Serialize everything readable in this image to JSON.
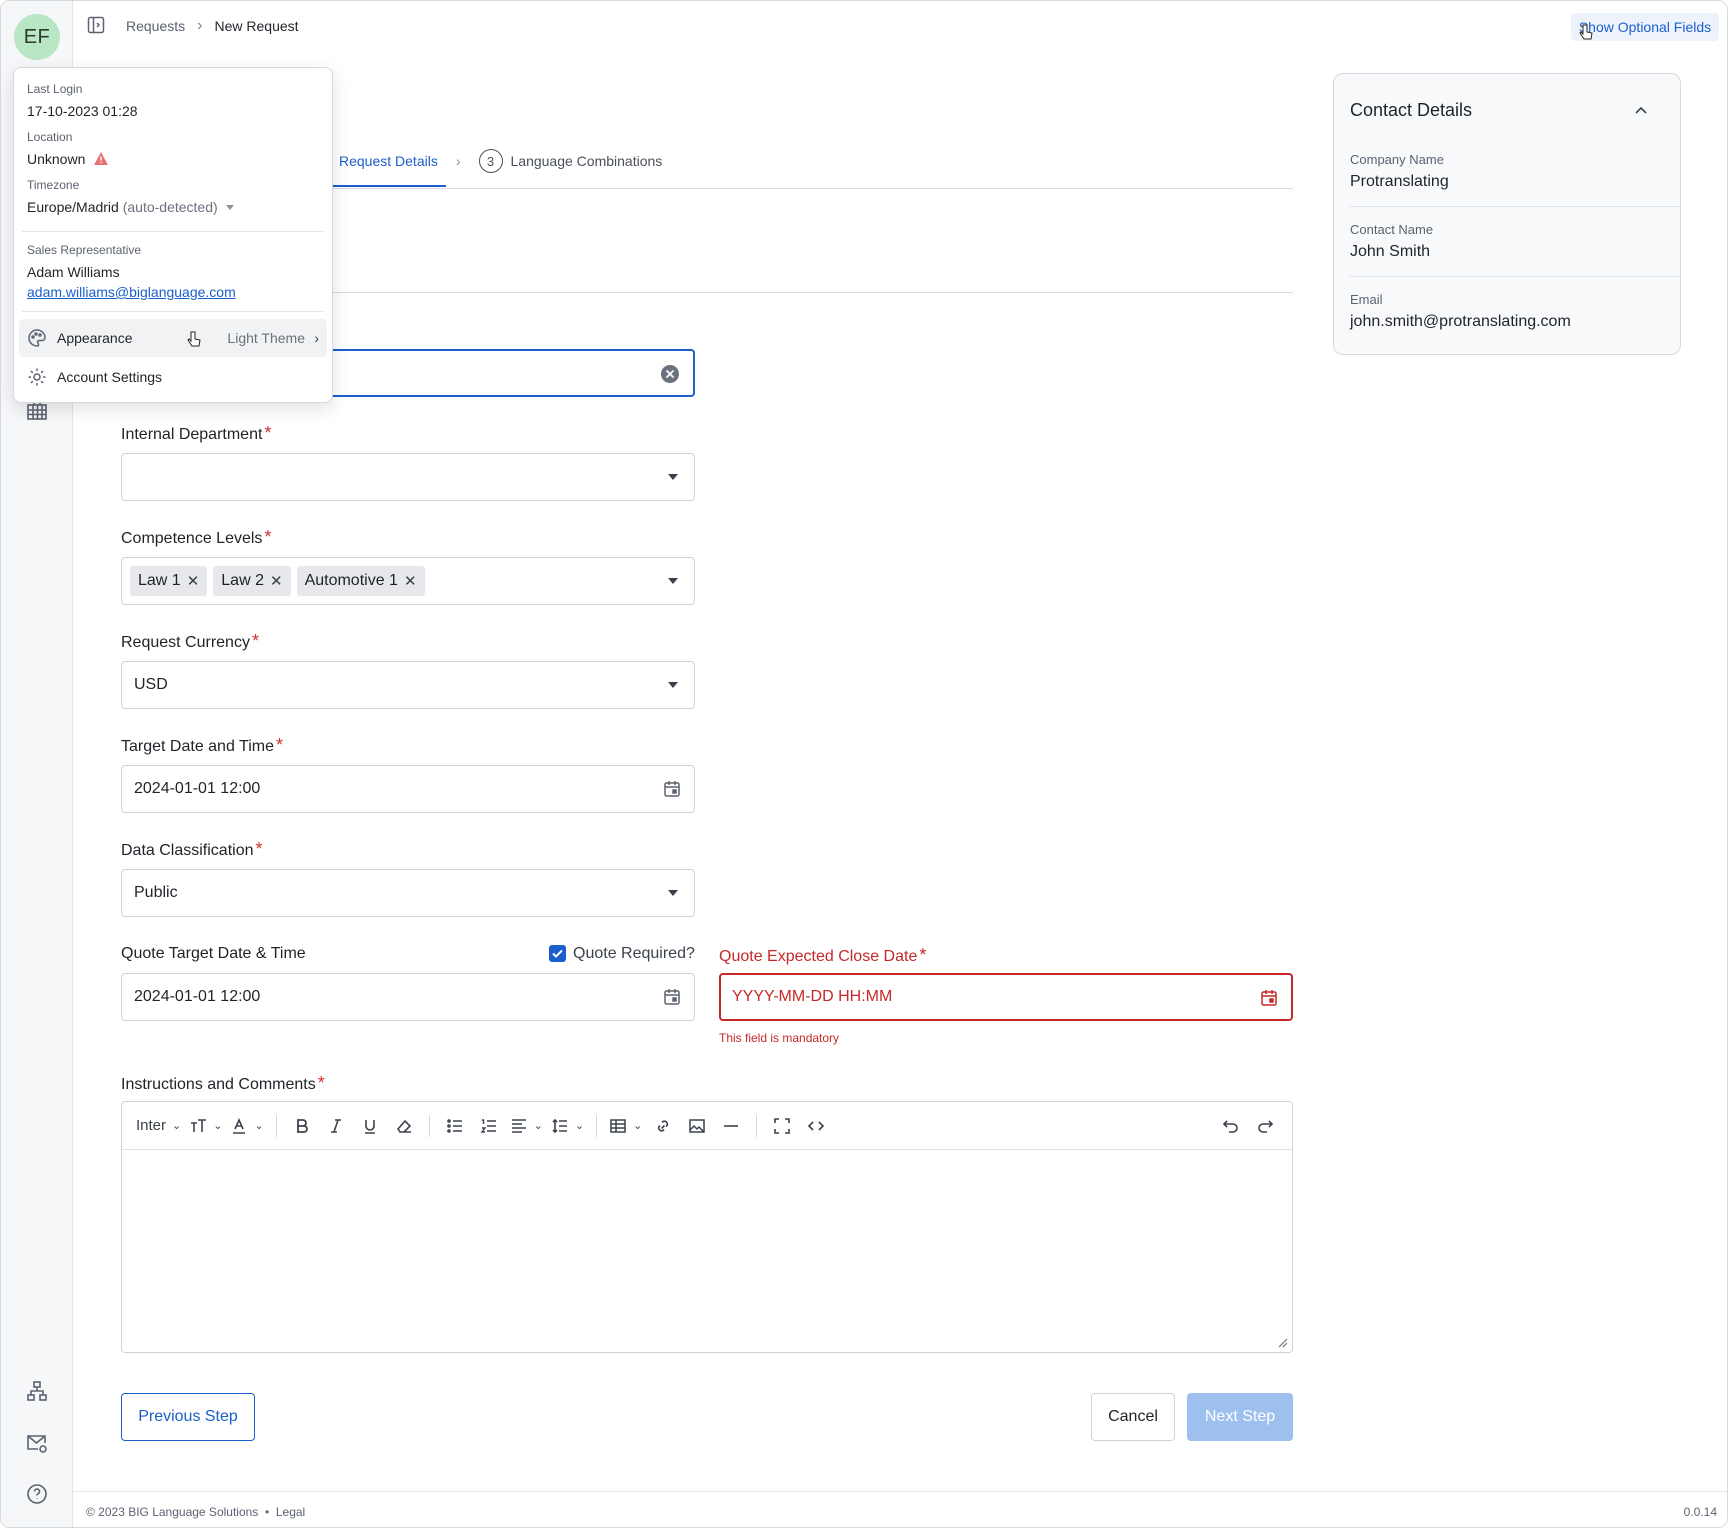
{
  "user": {
    "initials": "EF"
  },
  "breadcrumb": {
    "parent": "Requests",
    "current": "New Request"
  },
  "header": {
    "show_optional_fields": "Show Optional Fields"
  },
  "steps": {
    "active_label": "Request Details",
    "next_number": "3",
    "next_label": "Language Combinations"
  },
  "form": {
    "internal_department": {
      "label": "Internal Department",
      "value": ""
    },
    "competence_levels": {
      "label": "Competence Levels",
      "chips": [
        "Law 1",
        "Law 2",
        "Automotive 1"
      ]
    },
    "request_currency": {
      "label": "Request Currency",
      "value": "USD"
    },
    "target_date": {
      "label": "Target Date and Time",
      "value": "2024-01-01 12:00"
    },
    "data_classification": {
      "label": "Data Classification",
      "value": "Public"
    },
    "quote_target_date": {
      "label": "Quote Target Date & Time",
      "value": "2024-01-01 12:00"
    },
    "quote_required": {
      "label": "Quote Required?",
      "checked": true
    },
    "quote_close_date": {
      "label": "Quote Expected Close Date",
      "placeholder": "YYYY-MM-DD HH:MM",
      "error": "This field is mandatory"
    },
    "instructions": {
      "label": "Instructions and Comments",
      "font": "Inter"
    }
  },
  "buttons": {
    "previous": "Previous Step",
    "cancel": "Cancel",
    "next": "Next Step"
  },
  "footer": {
    "copyright": "© 2023 BIG Language Solutions",
    "legal": "Legal",
    "version": "0.0.14"
  },
  "contact": {
    "title": "Contact Details",
    "company_label": "Company Name",
    "company": "Protranslating",
    "name_label": "Contact Name",
    "name": "John Smith",
    "email_label": "Email",
    "email": "john.smith@protranslating.com"
  },
  "popup": {
    "last_login_label": "Last Login",
    "last_login": "17-10-2023 01:28",
    "location_label": "Location",
    "location": "Unknown",
    "timezone_label": "Timezone",
    "timezone": "Europe/Madrid",
    "timezone_note": "(auto-detected)",
    "sales_rep_label": "Sales Representative",
    "sales_rep_name": "Adam Williams",
    "sales_rep_email": "adam.williams@biglanguage.com",
    "appearance": "Appearance",
    "appearance_value": "Light Theme",
    "account_settings": "Account Settings"
  },
  "colors": {
    "accent": "#1b5fcc",
    "error": "#c62828",
    "avatar": "#b9e6c4"
  }
}
